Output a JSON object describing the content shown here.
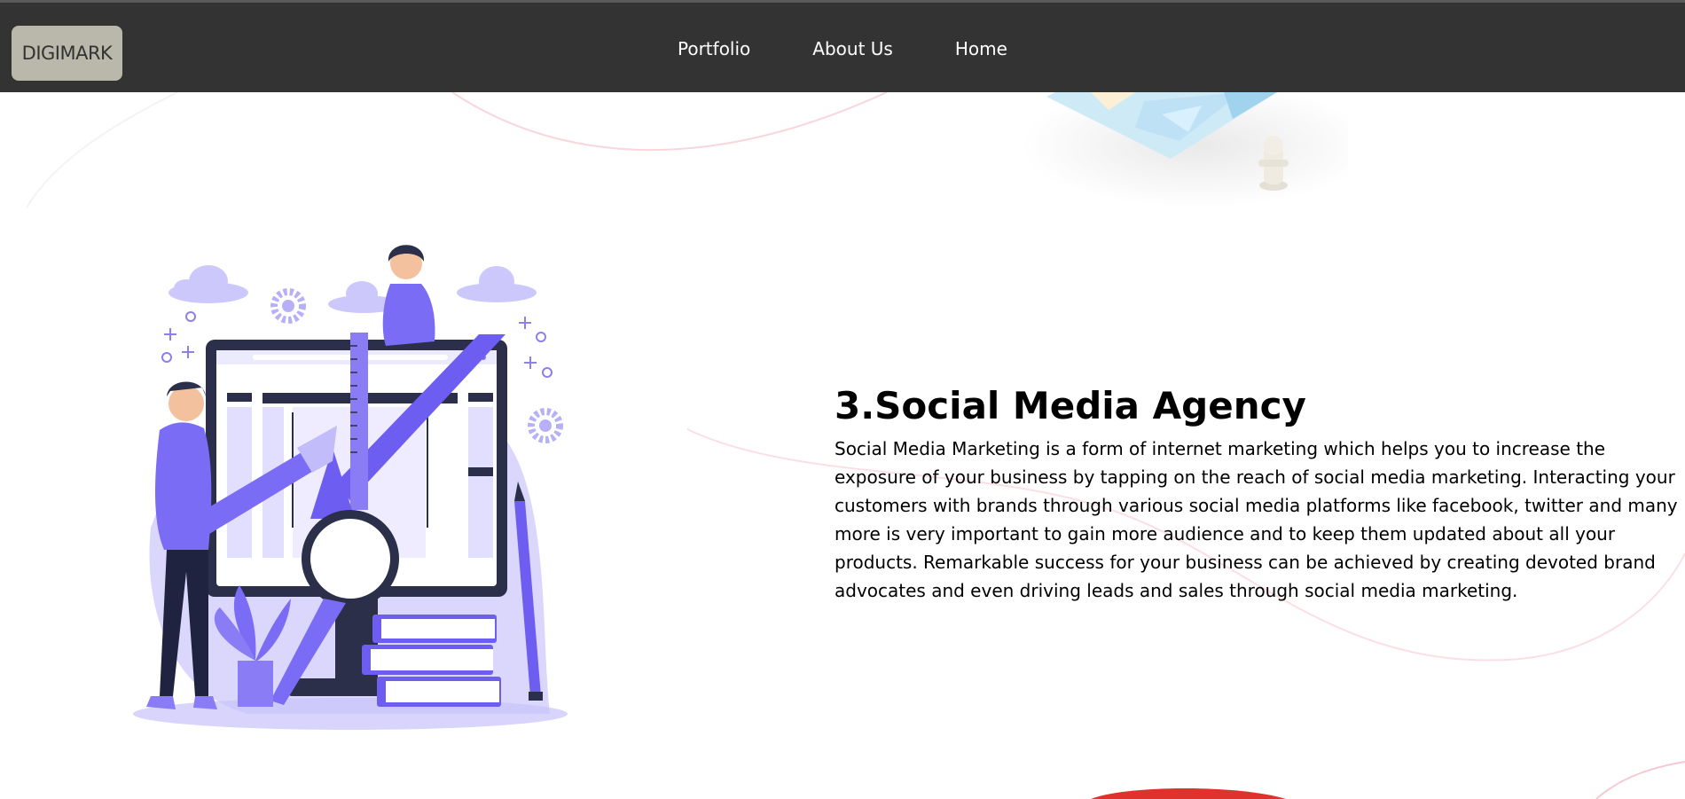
{
  "navbar": {
    "brand": "DIGIMARK",
    "links": [
      {
        "label": "Portfolio"
      },
      {
        "label": "About Us"
      },
      {
        "label": "Home"
      }
    ],
    "background": "#333333",
    "brand_background": "#b9b8aa"
  },
  "section": {
    "title": "3.Social Media Agency",
    "body": "Social Media Marketing is a form of internet marketing which helps you to increase the exposure of your business by tapping on the reach of social media marketing. Interacting your customers with brands through various social media platforms like facebook, twitter and many more is very important to gain more audience and to keep them updated about all your products. Remarkable success for your business can be achieved by creating devoted brand advocates and even driving leads and sales through social media marketing."
  },
  "illustration": {
    "icon": "digital-marketing-illustration",
    "accent": "#7b6cf6",
    "dark": "#2b2f4a"
  }
}
